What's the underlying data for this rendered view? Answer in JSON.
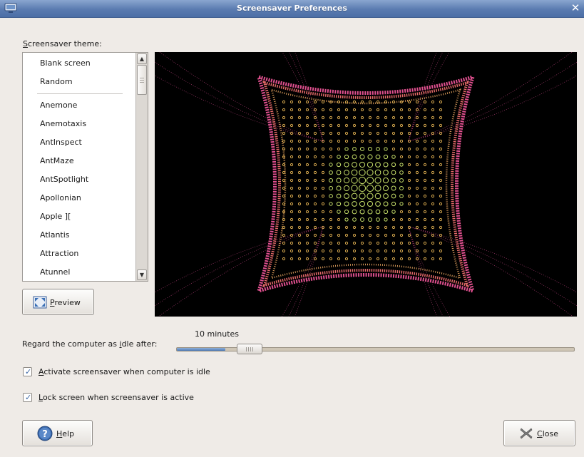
{
  "window": {
    "title": "Screensaver Preferences",
    "app_icon": "monitor-icon",
    "close_glyph": "✕"
  },
  "theme_label": "Screensaver theme:",
  "themes": {
    "special": [
      "Blank screen",
      "Random"
    ],
    "items": [
      "Anemone",
      "Anemotaxis",
      "AntInspect",
      "AntMaze",
      "AntSpotlight",
      "Apollonian",
      "Apple ][",
      "Atlantis",
      "Attraction",
      "Atunnel"
    ]
  },
  "preview_button": {
    "label": "Preview",
    "icon": "fullscreen-icon"
  },
  "idle": {
    "label": "Regard the computer as idle after:",
    "value": "10 minutes",
    "fraction": 0.09
  },
  "options": {
    "activate": {
      "label": "Activate screensaver when computer is idle",
      "checked": true
    },
    "lock": {
      "label": "Lock screen when screensaver is active",
      "checked": true
    }
  },
  "help_button": {
    "label": "Help",
    "icon": "help-icon"
  },
  "close_button": {
    "label": "Close",
    "icon": "close-icon"
  },
  "colors": {
    "titlebar": "#5a7bb0",
    "background": "#efebe7",
    "preview_bg": "#000000",
    "accent": "#4d79b5"
  }
}
